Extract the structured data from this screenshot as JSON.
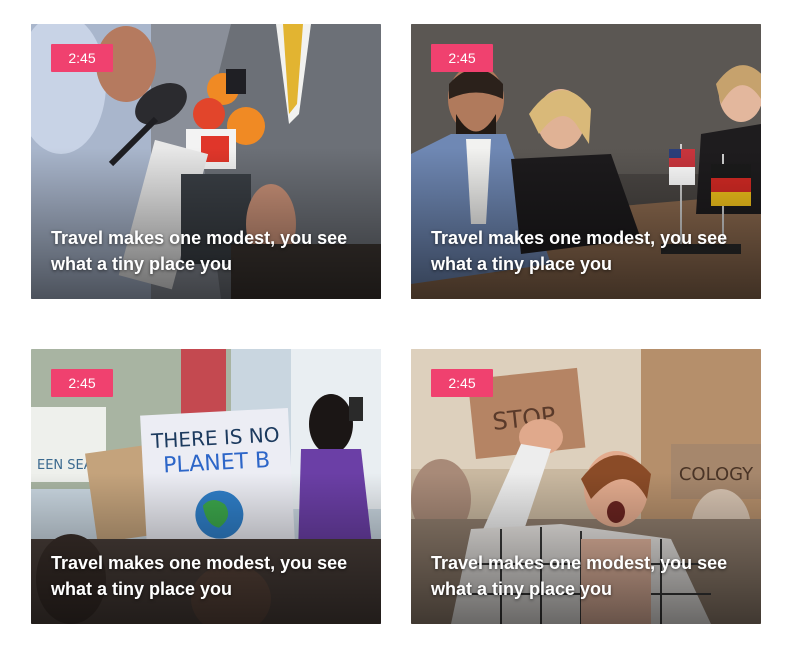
{
  "cards": [
    {
      "badge": "2:45",
      "title": "Travel makes one modest, you see what a tiny place you",
      "image": "press-microphones-photo"
    },
    {
      "badge": "2:45",
      "title": "Travel makes one modest, you see what a tiny place you",
      "image": "conference-flags-photo"
    },
    {
      "badge": "2:45",
      "title": "Travel makes one modest, you see what a tiny place you",
      "image": "climate-protest-sign-photo",
      "image_text": [
        "THERE IS NO",
        "PLANET B"
      ]
    },
    {
      "badge": "2:45",
      "title": "Travel makes one modest, you see what a tiny place you",
      "image": "protest-shouting-photo",
      "image_text": [
        "STOP",
        "ECOLOGY"
      ]
    }
  ],
  "colors": {
    "badge_bg": "#f0416f",
    "title_text": "#ffffff",
    "page_bg": "#ffffff"
  }
}
